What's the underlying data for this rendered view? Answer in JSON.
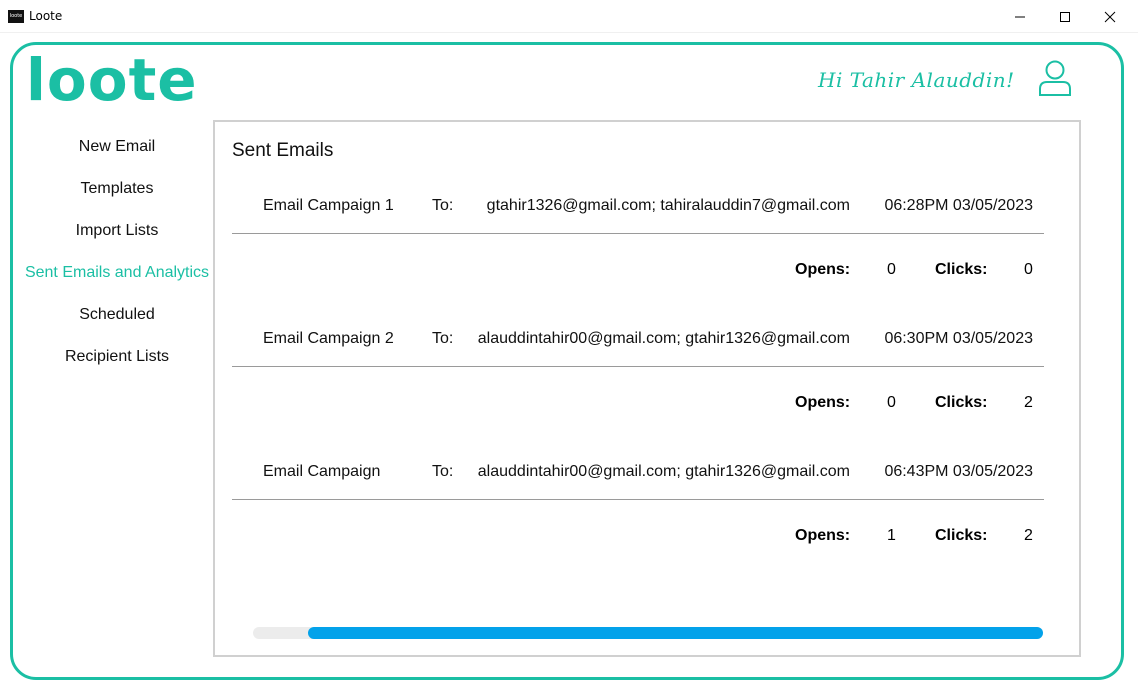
{
  "window": {
    "icon_text": "loote",
    "title": "Loote"
  },
  "header": {
    "logo": "loote",
    "greeting": "Hi Tahir Alauddin!",
    "user_icon": "user-icon"
  },
  "sidebar": {
    "items": [
      {
        "label": "New Email",
        "active": false
      },
      {
        "label": "Templates",
        "active": false
      },
      {
        "label": "Import Lists",
        "active": false
      },
      {
        "label": "Sent Emails and Analytics",
        "active": true
      },
      {
        "label": "Scheduled",
        "active": false
      },
      {
        "label": "Recipient Lists",
        "active": false
      }
    ]
  },
  "main": {
    "title": "Sent Emails",
    "to_label": "To:",
    "opens_label": "Opens:",
    "clicks_label": "Clicks:",
    "campaigns": [
      {
        "name": "Email Campaign 1",
        "recipients": "gtahir1326@gmail.com; tahiralauddin7@gmail.com",
        "sent_at": "06:28PM 03/05/2023",
        "opens": "0",
        "clicks": "0"
      },
      {
        "name": "Email Campaign 2",
        "recipients": "alauddintahir00@gmail.com; gtahir1326@gmail.com",
        "sent_at": "06:30PM 03/05/2023",
        "opens": "0",
        "clicks": "2"
      },
      {
        "name": "Email Campaign",
        "recipients": "alauddintahir00@gmail.com; gtahir1326@gmail.com",
        "sent_at": "06:43PM 03/05/2023",
        "opens": "1",
        "clicks": "2"
      }
    ],
    "scrollbar": {
      "position": 0.07,
      "visible_fraction": 0.93
    }
  },
  "colors": {
    "accent": "#1bbfa4",
    "scroll_thumb": "#03a2ea",
    "panel_border": "#d0d0d0"
  }
}
